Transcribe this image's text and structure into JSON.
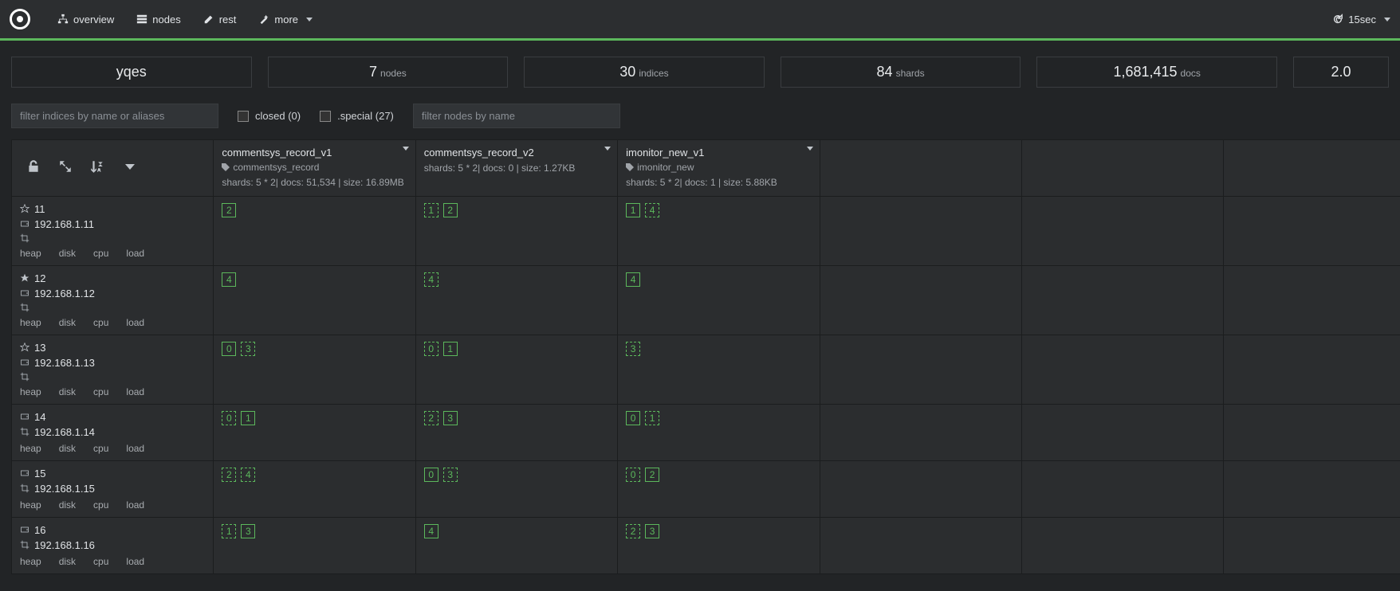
{
  "topbar": {
    "nav": [
      {
        "icon": "sitemap",
        "label": "overview"
      },
      {
        "icon": "nodes",
        "label": "nodes"
      },
      {
        "icon": "edit",
        "label": "rest"
      },
      {
        "icon": "magic",
        "label": "more"
      }
    ],
    "refresh": "15sec"
  },
  "stats": [
    {
      "num": "yqes",
      "lbl": ""
    },
    {
      "num": "7",
      "lbl": "nodes"
    },
    {
      "num": "30",
      "lbl": "indices"
    },
    {
      "num": "84",
      "lbl": "shards"
    },
    {
      "num": "1,681,415",
      "lbl": "docs"
    },
    {
      "num": "2.0",
      "lbl": ""
    }
  ],
  "filters": {
    "indices_placeholder": "filter indices by name or aliases",
    "nodes_placeholder": "filter nodes by name",
    "closed": "closed (0)",
    "special": ".special (27)"
  },
  "indices": [
    {
      "name": "commentsys_record_v1",
      "alias": "commentsys_record",
      "stats": "shards: 5 * 2| docs: 51,534 | size: 16.89MB"
    },
    {
      "name": "commentsys_record_v2",
      "alias": "",
      "stats": "shards: 5 * 2| docs: 0 | size: 1.27KB"
    },
    {
      "name": "imonitor_new_v1",
      "alias": "imonitor_new",
      "stats": "shards: 5 * 2| docs: 1 | size: 5.88KB"
    }
  ],
  "node_metric_labels": [
    "heap",
    "disk",
    "cpu",
    "load"
  ],
  "nodes": [
    {
      "star": "outline",
      "name": "11",
      "ip": "192.168.1.11",
      "crop": true,
      "shards": [
        [
          {
            "n": "2",
            "t": "primary"
          }
        ],
        [
          {
            "n": "1",
            "t": "replica"
          },
          {
            "n": "2",
            "t": "primary"
          }
        ],
        [
          {
            "n": "1",
            "t": "primary"
          },
          {
            "n": "4",
            "t": "replica"
          }
        ]
      ]
    },
    {
      "star": "solid",
      "name": "12",
      "ip": "192.168.1.12",
      "crop": true,
      "shards": [
        [
          {
            "n": "4",
            "t": "primary"
          }
        ],
        [
          {
            "n": "4",
            "t": "replica"
          }
        ],
        [
          {
            "n": "4",
            "t": "primary"
          }
        ]
      ]
    },
    {
      "star": "outline",
      "name": "13",
      "ip": "192.168.1.13",
      "crop": true,
      "shards": [
        [
          {
            "n": "0",
            "t": "primary"
          },
          {
            "n": "3",
            "t": "replica"
          }
        ],
        [
          {
            "n": "0",
            "t": "replica"
          },
          {
            "n": "1",
            "t": "primary"
          }
        ],
        [
          {
            "n": "3",
            "t": "replica"
          }
        ]
      ]
    },
    {
      "star": "",
      "name": "14",
      "ip": "192.168.1.14",
      "crop": true,
      "shards": [
        [
          {
            "n": "0",
            "t": "replica"
          },
          {
            "n": "1",
            "t": "primary"
          }
        ],
        [
          {
            "n": "2",
            "t": "replica"
          },
          {
            "n": "3",
            "t": "primary"
          }
        ],
        [
          {
            "n": "0",
            "t": "primary"
          },
          {
            "n": "1",
            "t": "replica"
          }
        ]
      ]
    },
    {
      "star": "",
      "name": "15",
      "ip": "192.168.1.15",
      "crop": true,
      "shards": [
        [
          {
            "n": "2",
            "t": "replica"
          },
          {
            "n": "4",
            "t": "replica"
          }
        ],
        [
          {
            "n": "0",
            "t": "primary"
          },
          {
            "n": "3",
            "t": "replica"
          }
        ],
        [
          {
            "n": "0",
            "t": "replica"
          },
          {
            "n": "2",
            "t": "primary"
          }
        ]
      ]
    },
    {
      "star": "",
      "name": "16",
      "ip": "192.168.1.16",
      "crop": true,
      "shards": [
        [
          {
            "n": "1",
            "t": "replica"
          },
          {
            "n": "3",
            "t": "primary"
          }
        ],
        [
          {
            "n": "4",
            "t": "primary"
          }
        ],
        [
          {
            "n": "2",
            "t": "replica"
          },
          {
            "n": "3",
            "t": "primary"
          }
        ]
      ]
    }
  ]
}
